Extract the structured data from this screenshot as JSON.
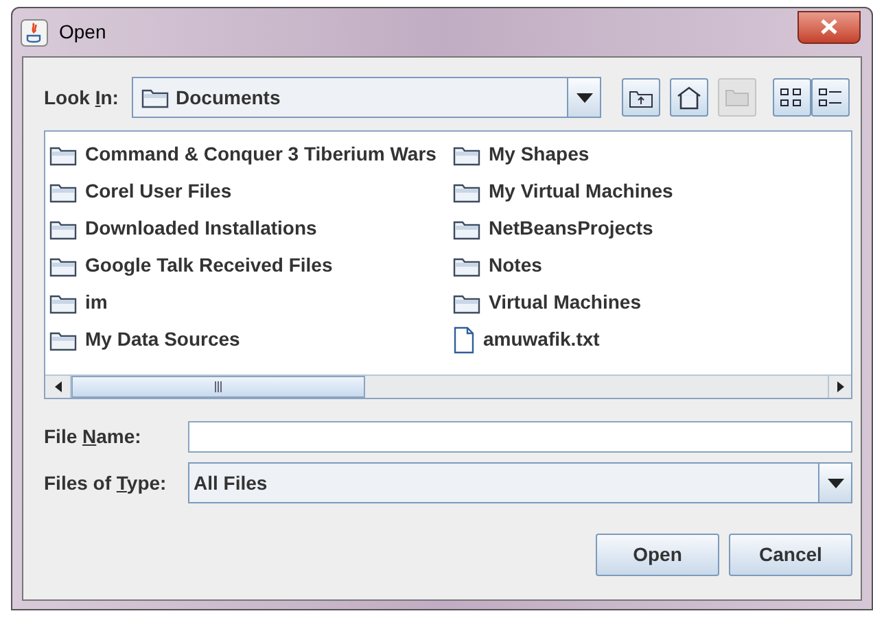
{
  "window": {
    "title": "Open"
  },
  "look_in": {
    "label": {
      "before": "Look ",
      "mnemonic": "I",
      "after": "n:"
    },
    "value": "Documents"
  },
  "files": [
    {
      "name": "Command & Conquer 3 Tiberium Wars",
      "kind": "folder"
    },
    {
      "name": "Corel User Files",
      "kind": "folder"
    },
    {
      "name": "Downloaded Installations",
      "kind": "folder"
    },
    {
      "name": "Google Talk Received Files",
      "kind": "folder"
    },
    {
      "name": "im",
      "kind": "folder"
    },
    {
      "name": "My Data Sources",
      "kind": "folder"
    },
    {
      "name": "My Shapes",
      "kind": "folder"
    },
    {
      "name": "My Virtual Machines",
      "kind": "folder"
    },
    {
      "name": "NetBeansProjects",
      "kind": "folder"
    },
    {
      "name": "Notes",
      "kind": "folder"
    },
    {
      "name": "Virtual Machines",
      "kind": "folder"
    },
    {
      "name": "amuwafik.txt",
      "kind": "file"
    }
  ],
  "file_name": {
    "label": {
      "before": "File ",
      "mnemonic": "N",
      "after": "ame:"
    }
  },
  "files_of_type": {
    "label": {
      "before": "Files of ",
      "mnemonic": "T",
      "after": "ype:"
    },
    "value": "All Files"
  },
  "buttons": [
    "Open",
    "Cancel"
  ]
}
